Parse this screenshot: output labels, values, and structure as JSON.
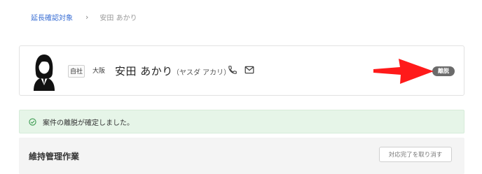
{
  "breadcrumb": {
    "parent_label": "延長確認対象",
    "separator": "›",
    "current_label": "安田 あかり"
  },
  "profile": {
    "company_tag": "自社",
    "branch": "大阪",
    "name": "安田 あかり",
    "kana": "（ヤスダ アカリ）",
    "icons": [
      "avatar-icon",
      "phone-icon",
      "mail-icon"
    ],
    "status_badge": "離脱"
  },
  "alert": {
    "icon": "check-circle-icon",
    "message": "案件の離脱が確定しました。"
  },
  "maintenance": {
    "title": "維持管理作業",
    "cancel_button_label": "対応完了を取り消す"
  },
  "colors": {
    "link": "#3b6fd4",
    "alert_bg": "#e6f5e8",
    "alert_icon": "#3a9a4f",
    "badge_bg": "#6b6b6b",
    "arrow": "#ff1a1a"
  }
}
